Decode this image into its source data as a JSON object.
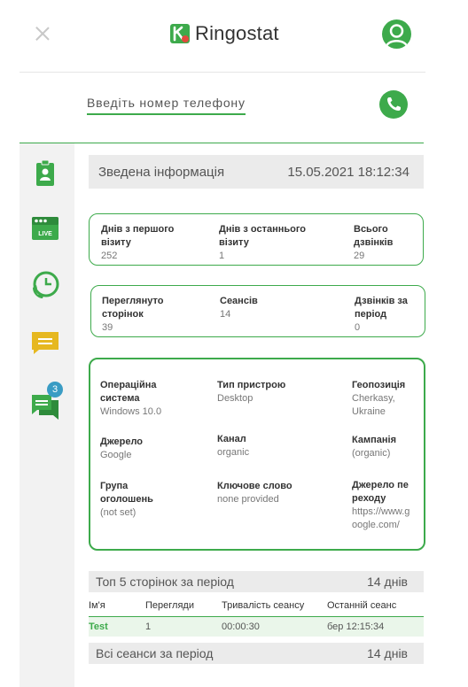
{
  "header": {
    "brand": "Ringostat",
    "icons": [
      "close-icon",
      "ringostat-logo-icon",
      "user-avatar-icon"
    ]
  },
  "phone": {
    "placeholder": "Введіть номер телефону",
    "call_icon": "phone-icon"
  },
  "sidebar": {
    "items": [
      {
        "name": "contact-card-icon"
      },
      {
        "name": "live-icon",
        "label": "LIVE"
      },
      {
        "name": "call-history-icon"
      },
      {
        "name": "message-icon"
      },
      {
        "name": "chat-icon",
        "badge": "3"
      }
    ]
  },
  "summary": {
    "title": "Зведена інформація",
    "datetime": "15.05.2021 18:12:34"
  },
  "stats1": [
    {
      "label": "Днів з першого візиту",
      "value": "252"
    },
    {
      "label": "Днів з останнього візиту",
      "value": "1"
    },
    {
      "label": "Всього дзвінків",
      "value": "29"
    }
  ],
  "stats2": [
    {
      "label": "Переглянуто сторінок",
      "value": "39"
    },
    {
      "label": "Сеансів",
      "value": "14"
    },
    {
      "label": "Дзвінків за період",
      "value": "0"
    }
  ],
  "details": [
    {
      "label": "Операційна система",
      "value": "Windows 10.0"
    },
    {
      "label": "Тип пристрою",
      "value": "Desktop"
    },
    {
      "label": "Геопозиція",
      "value": "Cherkasy, Ukraine"
    },
    {
      "label": "Джерело",
      "value": "Google"
    },
    {
      "label": "Канал",
      "value": "organic"
    },
    {
      "label": "Кампанія",
      "value": "(organic)"
    },
    {
      "label": "Група оголошень",
      "value": "(not set)"
    },
    {
      "label": "Ключове слово",
      "value": "none provided"
    },
    {
      "label": "Джерело переходу",
      "value": "https://www.google.com/"
    }
  ],
  "top_pages": {
    "title": "Топ 5 сторінок за період",
    "period": "14 днів",
    "columns": [
      "Ім'я",
      "Перегляди",
      "Тривалість сеансу",
      "Останній сеанс"
    ],
    "rows": [
      {
        "name": "Test",
        "views": "1",
        "duration": "00:00:30",
        "last": "бер 12:15:34"
      }
    ]
  },
  "sessions": {
    "title": "Всі сеанси за період",
    "period": "14 днів"
  },
  "colors": {
    "accent": "#3daa4b",
    "yellow": "#e6b820",
    "badge": "#3a9cc4",
    "logo_red": "#e2483d"
  }
}
